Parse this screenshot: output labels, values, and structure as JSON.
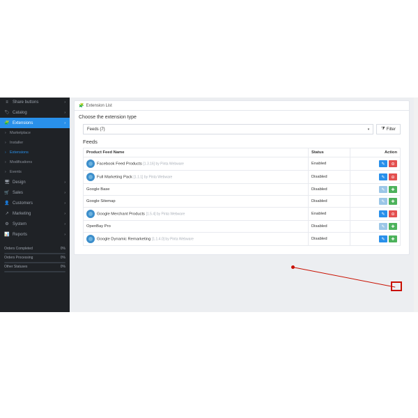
{
  "sidebar": {
    "items": [
      {
        "icon": "≡",
        "label": "Share buttons"
      },
      {
        "icon": "🏷",
        "label": "Catalog"
      },
      {
        "icon": "🧩",
        "label": "Extensions",
        "active": true
      },
      {
        "icon": "🖥",
        "label": "Design"
      },
      {
        "icon": "🛒",
        "label": "Sales"
      },
      {
        "icon": "👤",
        "label": "Customers"
      },
      {
        "icon": "↗",
        "label": "Marketing"
      },
      {
        "icon": "⚙",
        "label": "System"
      },
      {
        "icon": "📊",
        "label": "Reports"
      }
    ],
    "subitems": [
      {
        "label": "Marketplace"
      },
      {
        "label": "Installer"
      },
      {
        "label": "Extensions",
        "active": true
      },
      {
        "label": "Modifications"
      },
      {
        "label": "Events"
      }
    ],
    "orders": [
      {
        "label": "Orders Completed",
        "value": "0%"
      },
      {
        "label": "Orders Processing",
        "value": "0%"
      },
      {
        "label": "Other Statuses",
        "value": "0%"
      }
    ]
  },
  "panel": {
    "title": "Extension List",
    "choose": "Choose the extension type",
    "select_value": "Feeds (7)",
    "filter_label": "Filter",
    "feeds_heading": "Feeds"
  },
  "table": {
    "cols": {
      "name": "Product Feed Name",
      "status": "Status",
      "action": "Action"
    },
    "rows": [
      {
        "icon": true,
        "name": "Facebook Feed Products",
        "meta": "[1.3.16] by Pinta Webware",
        "status": "Enabled",
        "buttons": [
          "blue",
          "red"
        ]
      },
      {
        "icon": true,
        "name": "Full Marketing Pack",
        "meta": "[1.1.1] by Pinta Webware",
        "status": "Disabled",
        "buttons": [
          "blue",
          "red"
        ]
      },
      {
        "icon": false,
        "name": "Google Base",
        "meta": "",
        "status": "Disabled",
        "buttons": [
          "ltblue",
          "green"
        ]
      },
      {
        "icon": false,
        "name": "Google Sitemap",
        "meta": "",
        "status": "Disabled",
        "buttons": [
          "ltblue",
          "green"
        ]
      },
      {
        "icon": true,
        "name": "Google Merchant Products",
        "meta": "[1.5.4] by Pinta Webware",
        "status": "Enabled",
        "buttons": [
          "blue",
          "red"
        ]
      },
      {
        "icon": false,
        "name": "OpenBay Pro",
        "meta": "",
        "status": "Disabled",
        "buttons": [
          "ltblue",
          "green"
        ]
      },
      {
        "icon": true,
        "name": "Google Dynamic Remarketing",
        "meta": "[1.1.4.0] by Pinta Webware",
        "status": "Disabled",
        "buttons": [
          "blue",
          "green"
        ]
      }
    ]
  },
  "annotation": {
    "marker": "1"
  }
}
